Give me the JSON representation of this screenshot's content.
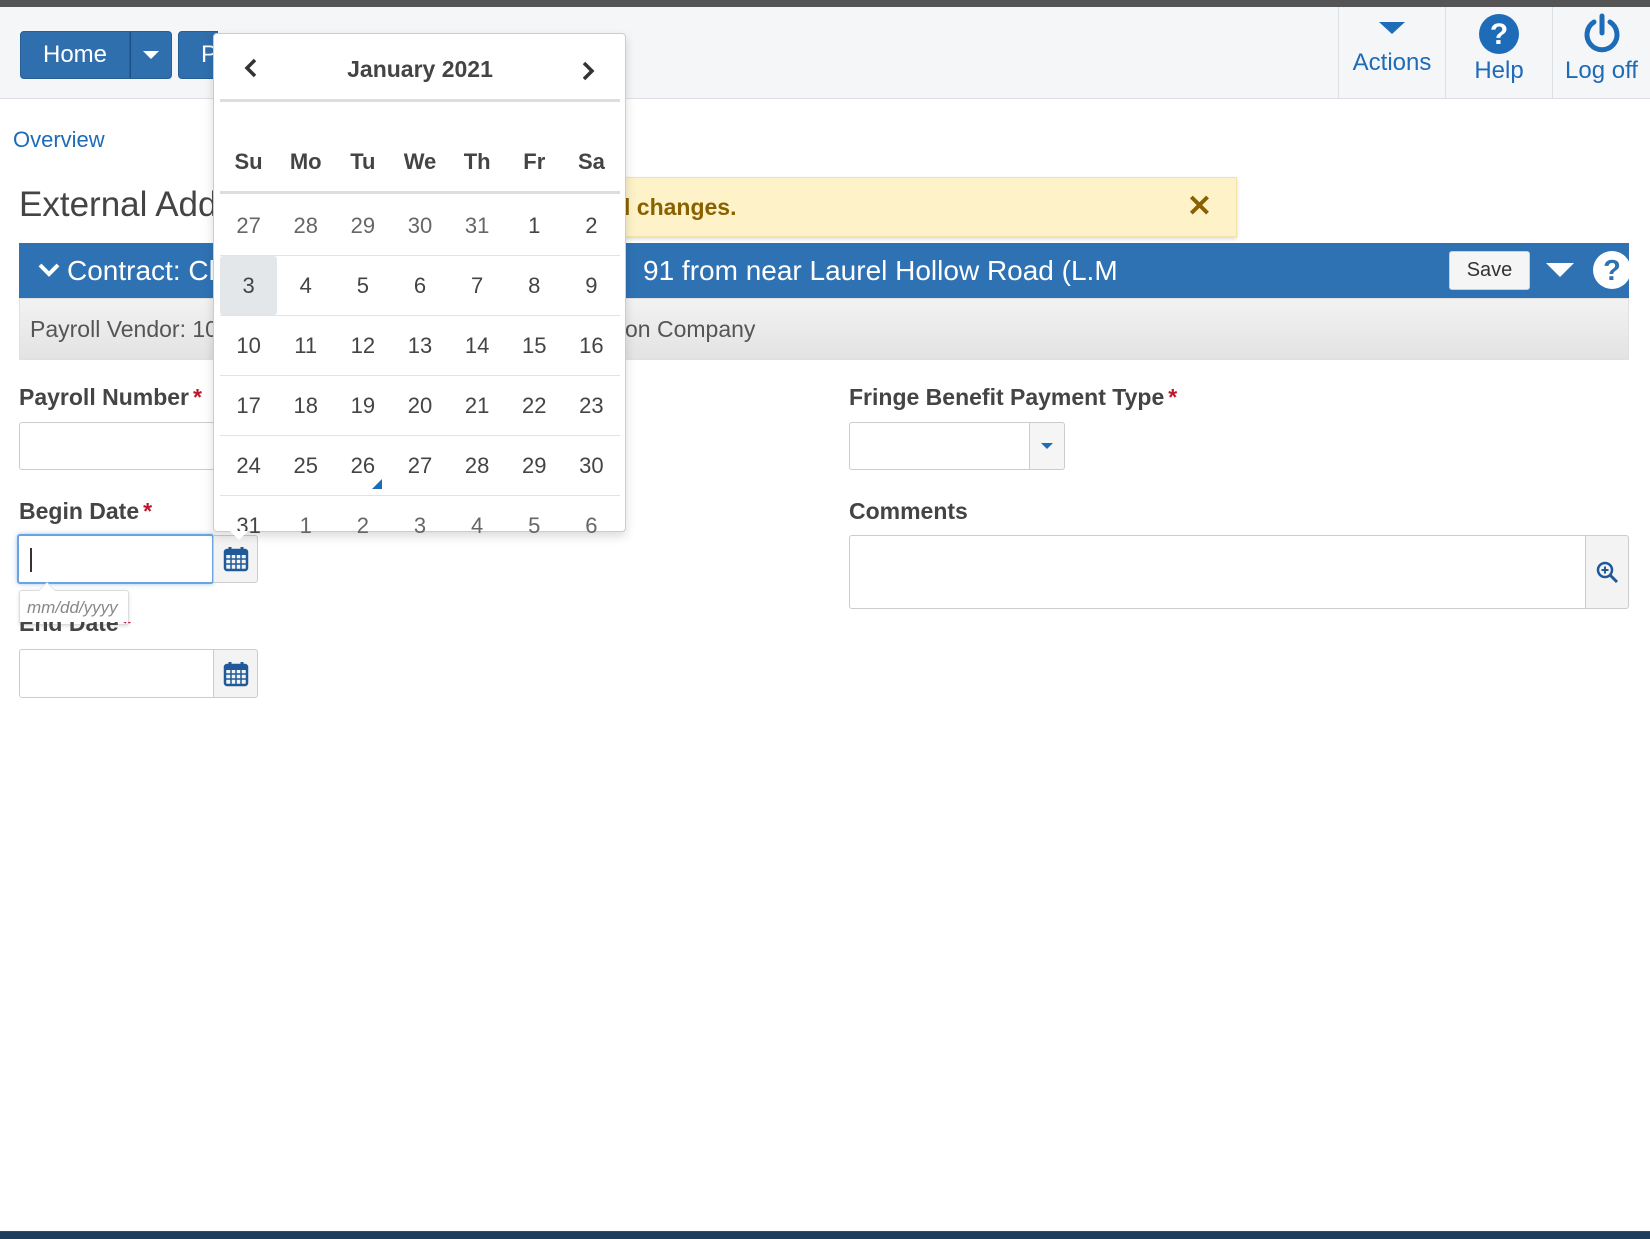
{
  "nav": {
    "home_label": "Home",
    "second_label": "P"
  },
  "top_actions": [
    {
      "label": "Actions",
      "icon": "caret-down-icon"
    },
    {
      "label": "Help",
      "icon": "question-circle-icon"
    },
    {
      "label": "Log off",
      "icon": "power-icon"
    }
  ],
  "breadcrumb": {
    "overview": "Overview"
  },
  "page": {
    "title": "External Add"
  },
  "warning": {
    "text": "l changes.",
    "close": "✕"
  },
  "contract": {
    "title_left": "Contract: Cl",
    "title_right": "91 from near Laurel Hollow Road (L.M",
    "save_label": "Save"
  },
  "subbar": {
    "vendor_left": "Payroll Vendor: 10",
    "vendor_right": "on Company"
  },
  "form": {
    "payroll_number_label": "Payroll Number",
    "begin_date_label": "Begin Date",
    "end_date_label": "End Date",
    "fringe_label": "Fringe Benefit Payment Type",
    "comments_label": "Comments",
    "required_mark": "*",
    "date_hint": "mm/dd/yyyy"
  },
  "calendar": {
    "month_label": "January 2021",
    "weekdays": [
      "Su",
      "Mo",
      "Tu",
      "We",
      "Th",
      "Fr",
      "Sa"
    ],
    "weeks": [
      [
        "27",
        "28",
        "29",
        "30",
        "31",
        "1",
        "2"
      ],
      [
        "3",
        "4",
        "5",
        "6",
        "7",
        "8",
        "9"
      ],
      [
        "10",
        "11",
        "12",
        "13",
        "14",
        "15",
        "16"
      ],
      [
        "17",
        "18",
        "19",
        "20",
        "21",
        "22",
        "23"
      ],
      [
        "24",
        "25",
        "26",
        "27",
        "28",
        "29",
        "30"
      ],
      [
        "31",
        "1",
        "2",
        "3",
        "4",
        "5",
        "6"
      ]
    ],
    "focused_day": "3",
    "today": "26"
  },
  "colors": {
    "primary": "#2f72b4",
    "link": "#1e6bb8",
    "warning_bg": "#fdf2c8",
    "warning_text": "#8a6100",
    "required": "#c0162c"
  }
}
